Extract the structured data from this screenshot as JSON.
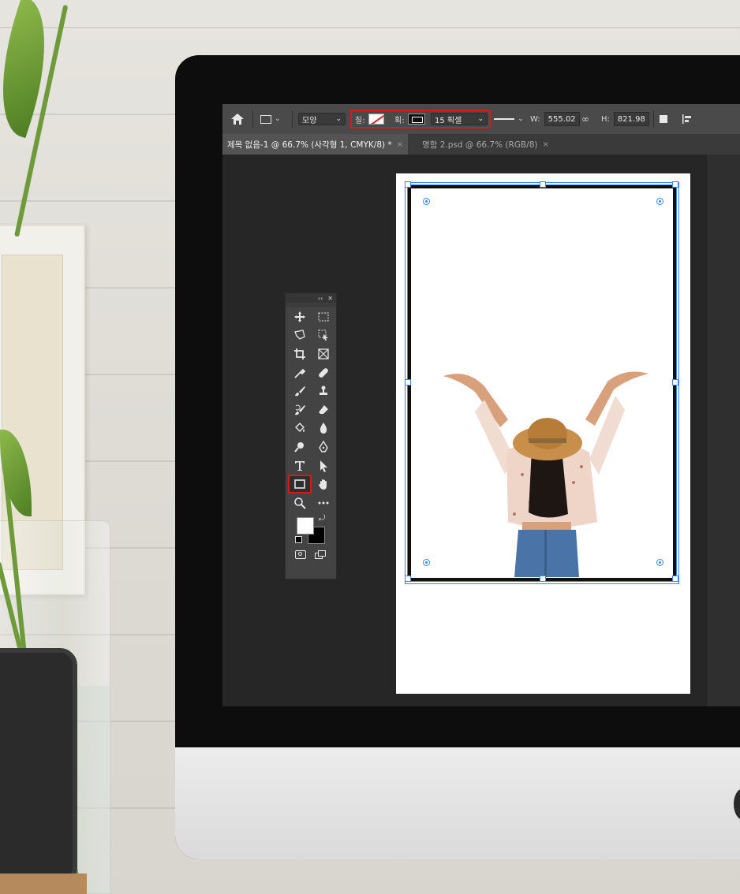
{
  "app": {
    "options_bar": {
      "shape_mode_label": "모양",
      "fill_label": "칠:",
      "stroke_label": "획:",
      "stroke_width_value": "15 픽셀",
      "width_label": "W:",
      "width_value": "555.02",
      "height_label": "H:",
      "height_value": "821.98"
    },
    "tabs": [
      {
        "label": "제목 없음-1 @ 66.7% (사각형 1, CMYK/8) *",
        "close": "×",
        "active": true
      },
      {
        "label": "명함 2.psd @ 66.7% (RGB/8)",
        "close": "×",
        "active": false
      }
    ],
    "tools_panel": {
      "collapse_glyph": "‹‹",
      "close_glyph": "✕",
      "selected_tool": "rectangle-tool"
    }
  },
  "colors": {
    "highlight": "#d31b1b",
    "selection_blue": "#3a87ff",
    "foreground": "#ffffff",
    "background": "#000000"
  }
}
